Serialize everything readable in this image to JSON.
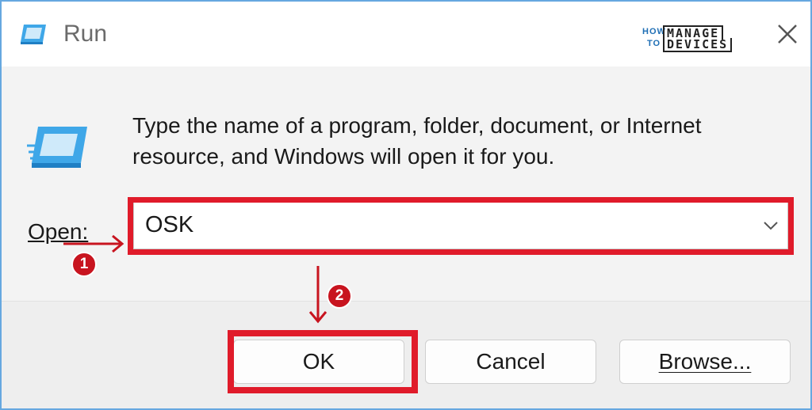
{
  "window": {
    "title": "Run",
    "close_icon": "close-icon",
    "app_icon": "run-app-icon"
  },
  "watermark": {
    "line1_small": "HOW",
    "line2_small": "TO",
    "line1_box": "MANAGE",
    "line2_box": "DEVICES"
  },
  "dialog": {
    "description": "Type the name of a program, folder, document, or Internet resource, and Windows will open it for you.",
    "open_label": "Open:",
    "open_value": "OSK"
  },
  "buttons": {
    "ok": "OK",
    "cancel": "Cancel",
    "browse": "Browse..."
  },
  "annotations": {
    "step1": "1",
    "step2": "2",
    "highlight_color": "#e01b2a",
    "badge_color": "#c8141f"
  }
}
